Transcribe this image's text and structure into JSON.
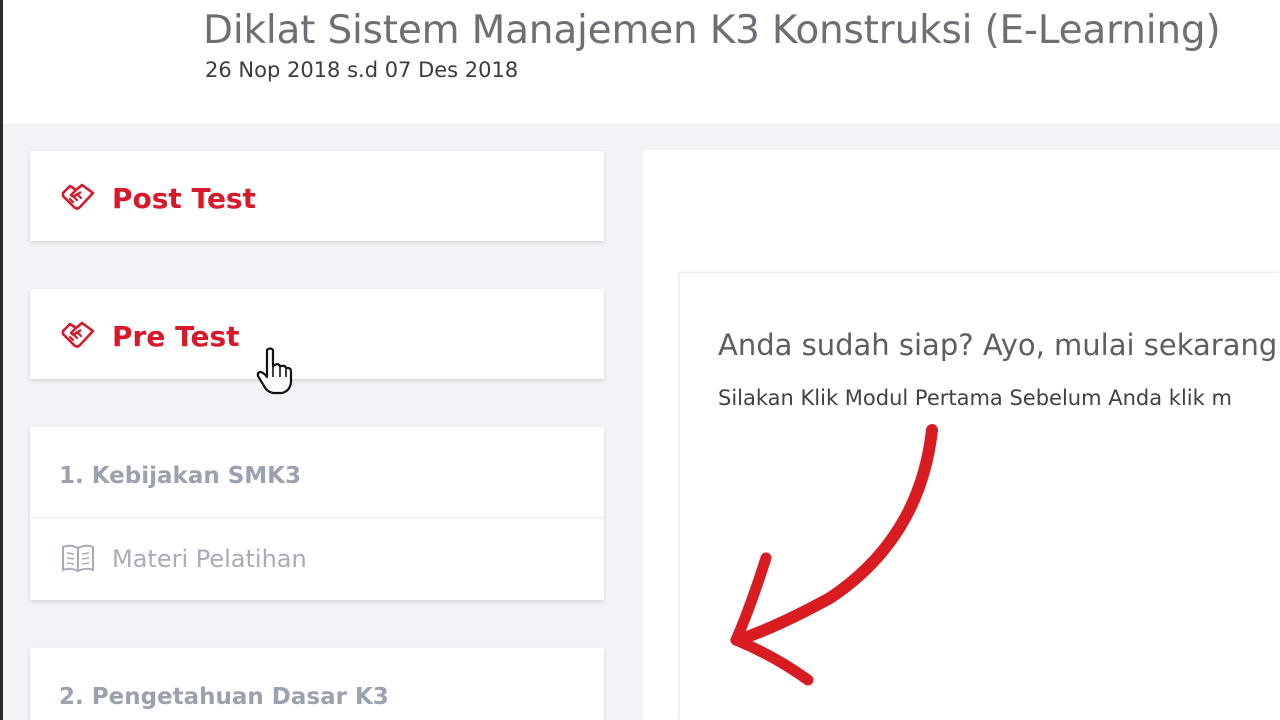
{
  "header": {
    "title": "Diklat Sistem Manajemen K3 Konstruksi (E-Learning)",
    "dates": "26 Nop 2018 s.d 07 Des 2018"
  },
  "sidebar": {
    "tests": [
      {
        "label": "Post Test",
        "icon": "handshake-icon"
      },
      {
        "label": "Pre Test",
        "icon": "handshake-icon"
      }
    ],
    "modules": [
      {
        "title": "1. Kebijakan SMK3",
        "material_label": "Materi Pelatihan",
        "icon": "book-icon"
      },
      {
        "title": "2. Pengetahuan Dasar K3"
      }
    ]
  },
  "main": {
    "ready_text": "Anda sudah siap? Ayo, mulai sekarang",
    "instruction_text": "Silakan Klik Modul Pertama Sebelum Anda klik m"
  },
  "colors": {
    "accent_red": "#d8182b",
    "muted_gray": "#9ba2ae",
    "background": "#f2f3f6"
  }
}
